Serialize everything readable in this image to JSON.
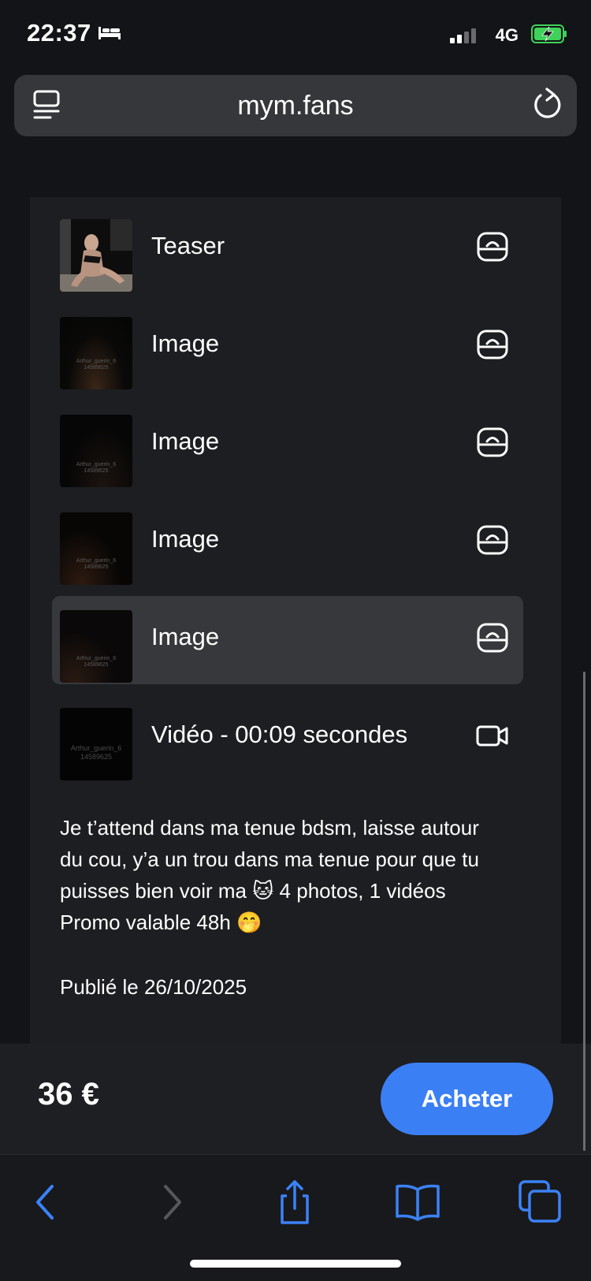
{
  "status_bar": {
    "time": "22:37",
    "network": "4G",
    "battery_charging": true
  },
  "address_bar": {
    "title": "mym.fans"
  },
  "media_items": [
    {
      "label": "Teaser",
      "type_icon": "image-locked-icon",
      "thumb_watermark": ""
    },
    {
      "label": "Image",
      "type_icon": "image-locked-icon",
      "thumb_watermark": "Arthur_guerin_6\n14589625"
    },
    {
      "label": "Image",
      "type_icon": "image-locked-icon",
      "thumb_watermark": "Arthur_guerin_6\n14589625"
    },
    {
      "label": "Image",
      "type_icon": "image-locked-icon",
      "thumb_watermark": "Arthur_guerin_6\n14589625"
    },
    {
      "label": "Image",
      "type_icon": "image-locked-icon",
      "thumb_watermark": "Arthur_guerin_6\n14589625",
      "highlighted": true
    },
    {
      "label": "Vidéo - 00:09 secondes",
      "type_icon": "video-camera-icon",
      "thumb_watermark": "Arthur_guerin_6\n14589625"
    }
  ],
  "description": {
    "line1": "Je t’attend dans ma tenue bdsm, laisse autour",
    "line2": "du cou, y’a un trou dans ma tenue pour que tu",
    "line3": "puisses bien voir ma 🐱 4 photos, 1 vidéos",
    "line4": "Promo valable 48h 🤭"
  },
  "published": "Publié le 26/10/2025",
  "purchase": {
    "price": "36 €",
    "button_label": "Acheter"
  },
  "colors": {
    "accent": "#3b7ff5",
    "toolbar_icon": "#3b82f6",
    "background": "#131417"
  }
}
